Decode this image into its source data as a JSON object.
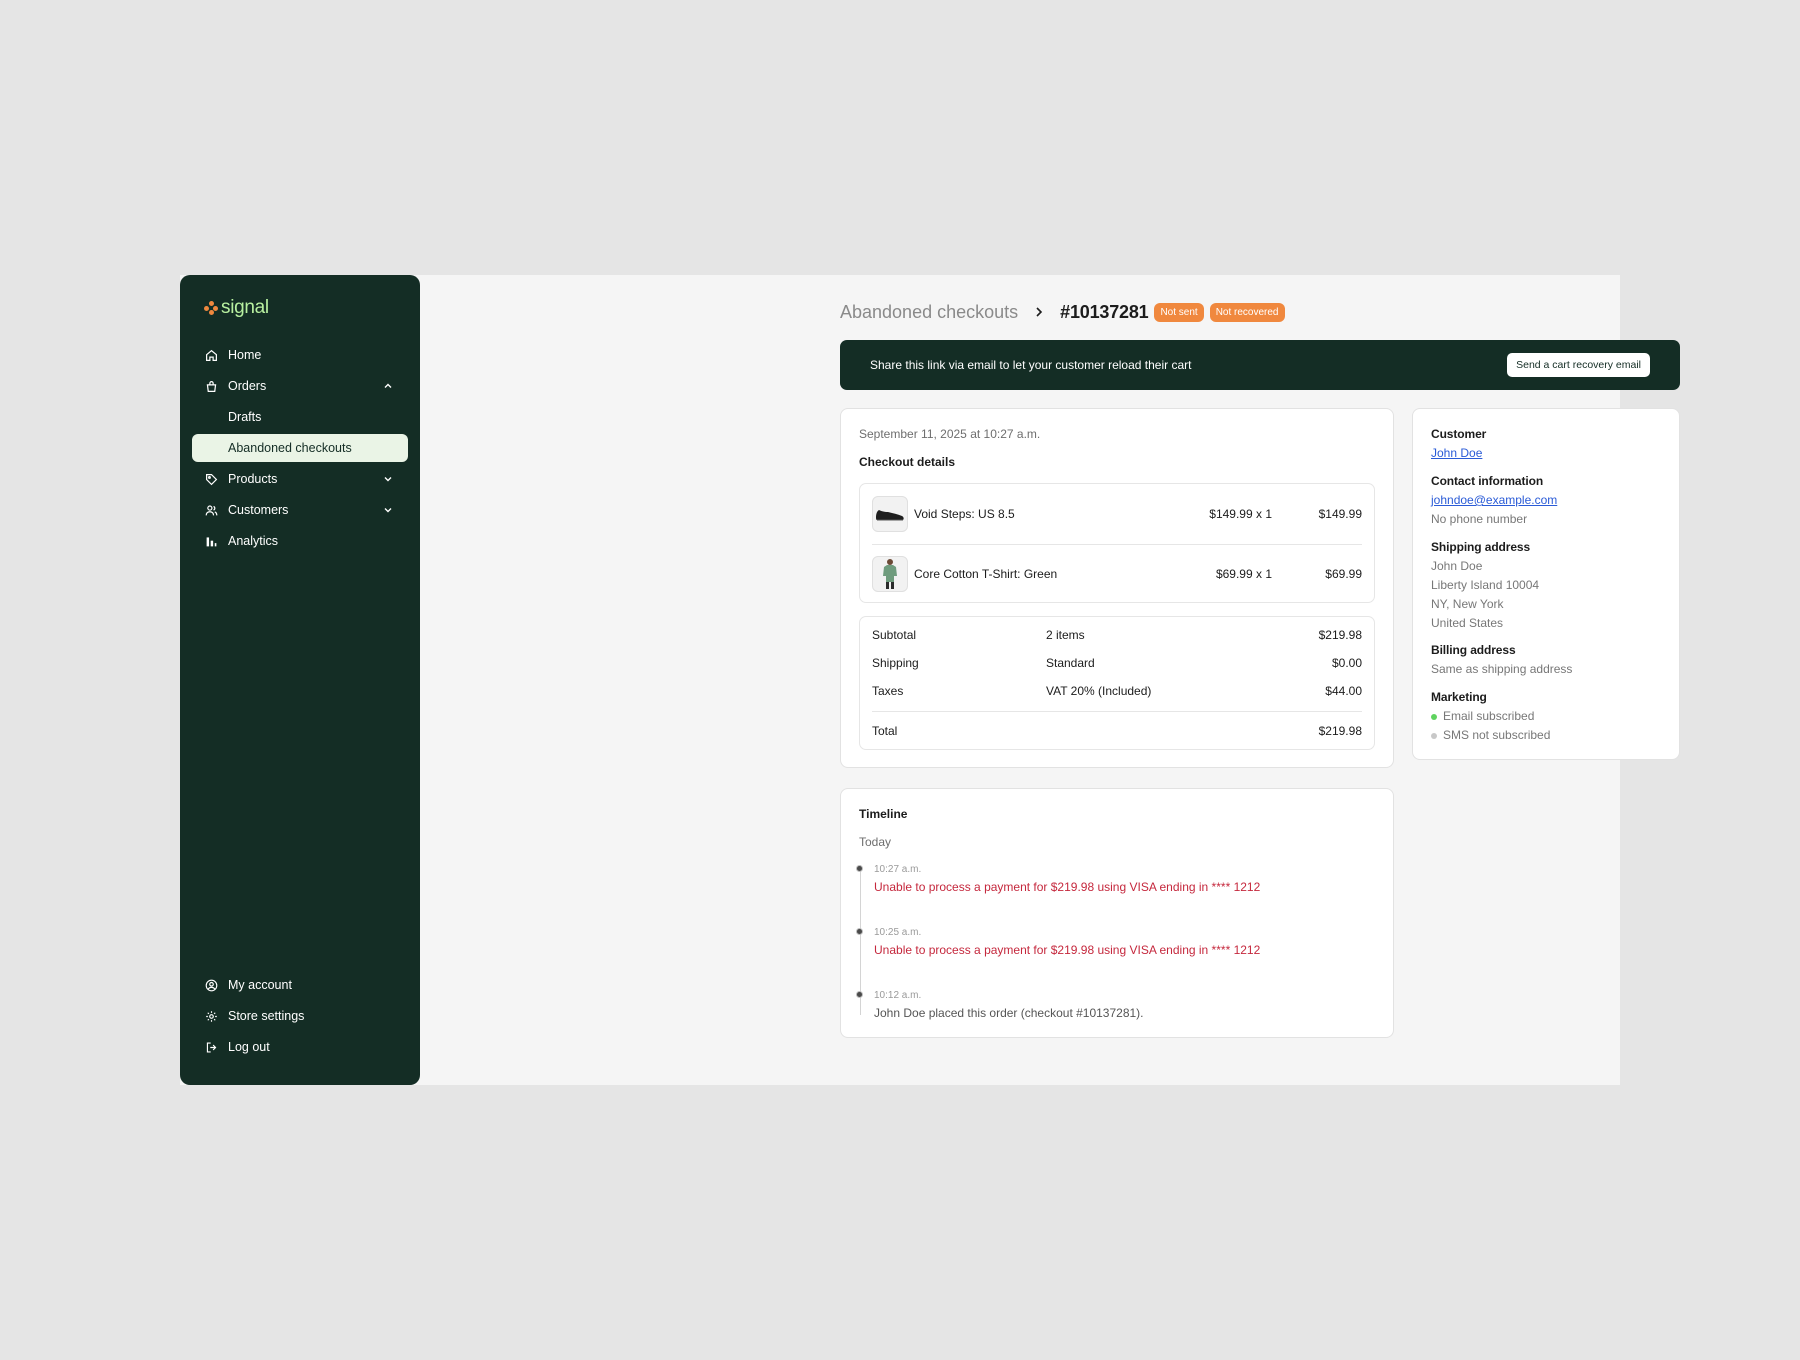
{
  "brand": {
    "name": "signal"
  },
  "sidebar": {
    "items": [
      {
        "label": "Home",
        "icon": "home-icon"
      },
      {
        "label": "Orders",
        "icon": "orders-icon"
      },
      {
        "label": "Drafts"
      },
      {
        "label": "Abandoned checkouts"
      },
      {
        "label": "Products",
        "icon": "tag-icon"
      },
      {
        "label": "Customers",
        "icon": "users-icon"
      },
      {
        "label": "Analytics",
        "icon": "bar-chart-icon"
      }
    ],
    "bottom": [
      {
        "label": "My account",
        "icon": "user-circle-icon"
      },
      {
        "label": "Store settings",
        "icon": "gear-icon"
      },
      {
        "label": "Log out",
        "icon": "logout-icon"
      }
    ]
  },
  "header": {
    "parent": "Abandoned checkouts",
    "id": "#10137281",
    "badges": [
      "Not sent",
      "Not recovered"
    ]
  },
  "banner": {
    "text": "Share this link via email to let your customer reload their cart",
    "button": "Send a cart recovery email"
  },
  "checkout": {
    "date": "September 11, 2025 at 10:27 a.m.",
    "title": "Checkout details",
    "items": [
      {
        "name": "Void Steps: US 8.5",
        "unit": "$149.99 x 1",
        "total": "$149.99",
        "thumb": "shoe"
      },
      {
        "name": "Core Cotton T-Shirt: Green",
        "unit": "$69.99 x 1",
        "total": "$69.99",
        "thumb": "tshirt"
      }
    ],
    "totals": [
      {
        "label": "Subtotal",
        "mid": "2 items",
        "value": "$219.98"
      },
      {
        "label": "Shipping",
        "mid": "Standard",
        "value": "$0.00"
      },
      {
        "label": "Taxes",
        "mid": "VAT 20% (Included)",
        "value": "$44.00"
      }
    ],
    "total": {
      "label": "Total",
      "value": "$219.98"
    }
  },
  "timeline": {
    "title": "Timeline",
    "day": "Today",
    "events": [
      {
        "time": "10:27 a.m.",
        "message": "Unable to process a payment for $219.98 using VISA ending in **** 1212",
        "type": "error"
      },
      {
        "time": "10:25 a.m.",
        "message": "Unable to process a payment for $219.98 using VISA ending in **** 1212",
        "type": "error"
      },
      {
        "time": "10:12 a.m.",
        "message": "John Doe placed this order (checkout #10137281).",
        "type": "normal"
      }
    ]
  },
  "customer": {
    "label": "Customer",
    "name": "John Doe",
    "contact_label": "Contact information",
    "email": "johndoe@example.com",
    "phone": "No phone number",
    "shipping_label": "Shipping address",
    "shipping": [
      "John Doe",
      "Liberty Island 10004",
      "NY, New York",
      "United States"
    ],
    "billing_label": "Billing address",
    "billing": "Same as shipping address",
    "marketing_label": "Marketing",
    "marketing": [
      {
        "label": "Email subscribed",
        "color": "#5fd35f"
      },
      {
        "label": "SMS not subscribed",
        "color": "#c8c8c8"
      }
    ]
  },
  "colors": {
    "sidebar": "#142d25",
    "accent": "#f0883e",
    "error": "#c5283d",
    "link": "#2a5bd7"
  }
}
